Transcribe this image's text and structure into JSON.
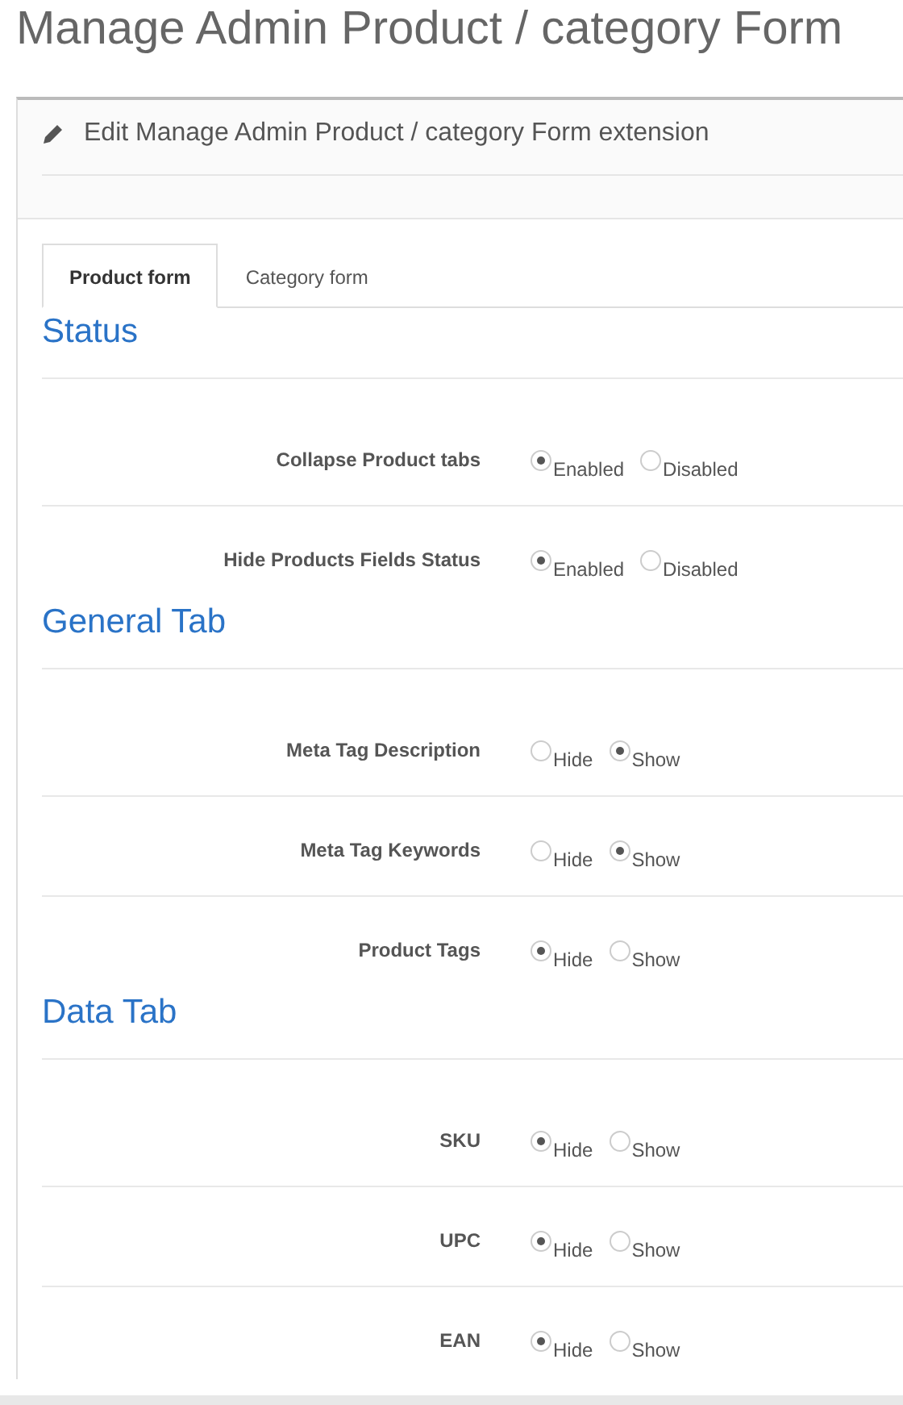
{
  "page_title": "Manage Admin Product / category Form",
  "panel": {
    "heading": "Edit Manage Admin Product / category Form extension"
  },
  "tabs": [
    {
      "label": "Product form",
      "selected": true
    },
    {
      "label": "Category form",
      "selected": false
    }
  ],
  "sections": [
    {
      "title": "Status",
      "rows": [
        {
          "label": "Collapse Product tabs",
          "options": [
            {
              "label": "Enabled",
              "selected": true
            },
            {
              "label": "Disabled",
              "selected": false
            }
          ]
        },
        {
          "label": "Hide Products Fields Status",
          "options": [
            {
              "label": "Enabled",
              "selected": true
            },
            {
              "label": "Disabled",
              "selected": false
            }
          ]
        }
      ]
    },
    {
      "title": "General Tab",
      "rows": [
        {
          "label": "Meta Tag Description",
          "options": [
            {
              "label": "Hide",
              "selected": false
            },
            {
              "label": "Show",
              "selected": true
            }
          ]
        },
        {
          "label": "Meta Tag Keywords",
          "options": [
            {
              "label": "Hide",
              "selected": false
            },
            {
              "label": "Show",
              "selected": true
            }
          ]
        },
        {
          "label": "Product Tags",
          "options": [
            {
              "label": "Hide",
              "selected": true
            },
            {
              "label": "Show",
              "selected": false
            }
          ]
        }
      ]
    },
    {
      "title": "Data Tab",
      "rows": [
        {
          "label": "SKU",
          "options": [
            {
              "label": "Hide",
              "selected": true
            },
            {
              "label": "Show",
              "selected": false
            }
          ]
        },
        {
          "label": "UPC",
          "options": [
            {
              "label": "Hide",
              "selected": true
            },
            {
              "label": "Show",
              "selected": false
            }
          ]
        },
        {
          "label": "EAN",
          "options": [
            {
              "label": "Hide",
              "selected": true
            },
            {
              "label": "Show",
              "selected": false
            }
          ]
        }
      ]
    }
  ]
}
